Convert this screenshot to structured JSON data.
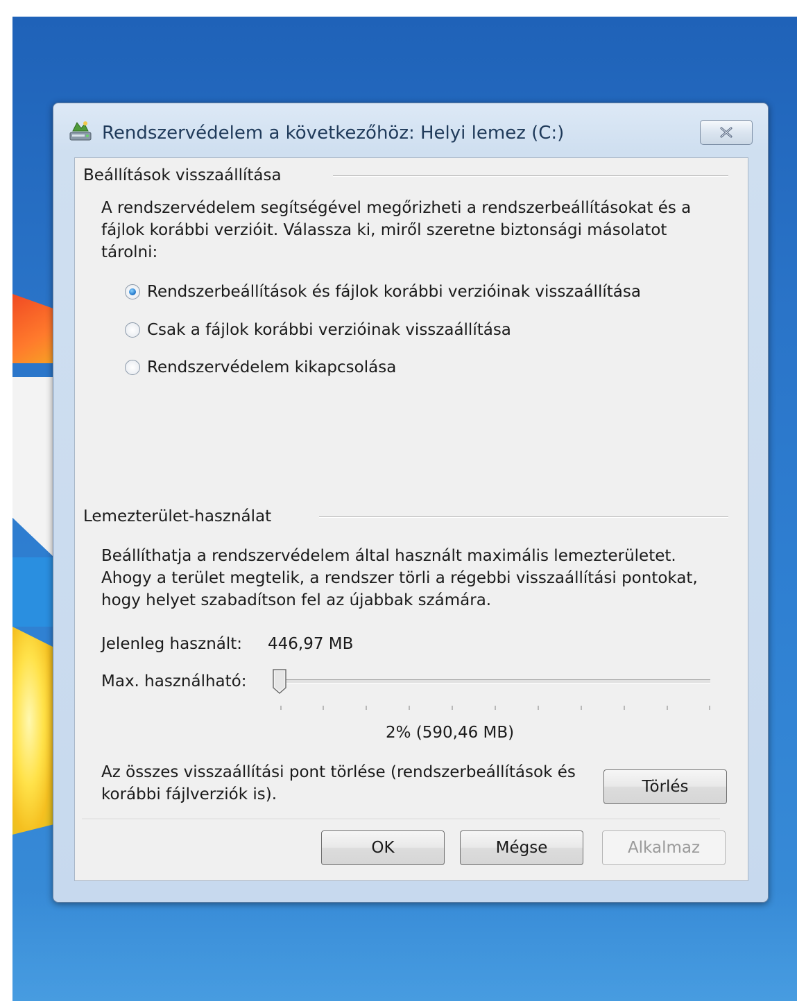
{
  "window": {
    "title": "Rendszervédelem a következőhöz: Helyi lemez (C:)",
    "close_icon": "close-icon",
    "title_icon": "system-protection-icon"
  },
  "restore_settings": {
    "label": "Beállítások visszaállítása",
    "description_lines": [
      "A rendszervédelem segítségével megőrizheti a rendszerbeállításokat és a",
      "fájlok korábbi verzióit. Válassza ki, miről szeretne biztonsági másolatot",
      "tárolni:"
    ],
    "options": [
      {
        "label": "Rendszerbeállítások és fájlok korábbi verzióinak visszaállítása",
        "checked": true
      },
      {
        "label": "Csak a fájlok korábbi verzióinak visszaállítása",
        "checked": false
      },
      {
        "label": "Rendszervédelem kikapcsolása",
        "checked": false
      }
    ]
  },
  "disk_usage": {
    "label": "Lemezterület-használat",
    "description_lines": [
      "Beállíthatja a rendszervédelem által használt maximális lemezterületet.",
      "Ahogy a terület megtelik, a rendszer törli a régebbi visszaállítási pontokat,",
      "hogy helyet szabadítson fel az újabbak számára."
    ],
    "current_label": "Jelenleg használt:",
    "current_value": "446,97 MB",
    "max_label": "Max. használható:",
    "slider_percent": 2,
    "slider_value_text": "2% (590,46 MB)",
    "delete_text_lines": [
      "Az összes visszaállítási pont törlése (rendszerbeállítások és",
      "korábbi fájlverziók is)."
    ],
    "delete_button": "Törlés"
  },
  "buttons": {
    "ok": "OK",
    "cancel": "Mégse",
    "apply": "Alkalmaz"
  }
}
